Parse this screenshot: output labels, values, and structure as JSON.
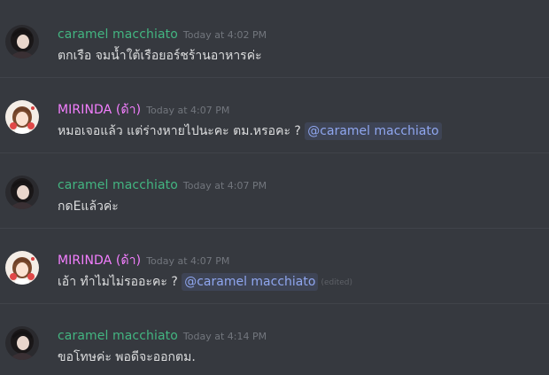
{
  "colors": {
    "background": "#36393f",
    "username_caramel": "#43b581",
    "username_mirinda": "#f47fff",
    "text": "#dcddde",
    "timestamp": "#72767d",
    "mention": "#8fa6ef"
  },
  "messages": [
    {
      "author": "caramel macchiato",
      "timestamp": "Today at 4:02 PM",
      "text": "ตกเรือ จมน้ำใต้เรือยอร์ชร้านอาหารค่ะ",
      "avatar_icon": "dark-hair-avatar"
    },
    {
      "author": "MIRINDA (ด้า)",
      "timestamp": "Today at 4:07 PM",
      "text": "หมอเจอแล้ว แต่ร่างหายไปนะคะ ตม.หรอคะ ? ",
      "mention": "@caramel macchiato",
      "avatar_icon": "anime-girl-avatar"
    },
    {
      "author": "caramel macchiato",
      "timestamp": "Today at 4:07 PM",
      "text": "กดEแล้วค่ะ",
      "avatar_icon": "dark-hair-avatar"
    },
    {
      "author": "MIRINDA (ด้า)",
      "timestamp": "Today at 4:07 PM",
      "text": "เอ้า ทำไมไม่รออะคะ ? ",
      "mention": "@caramel macchiato",
      "edited": "(edited)",
      "avatar_icon": "anime-girl-avatar"
    },
    {
      "author": "caramel macchiato",
      "timestamp": "Today at 4:14 PM",
      "text": "ขอโทษค่ะ พอดีจะออกตม.",
      "avatar_icon": "dark-hair-avatar"
    }
  ]
}
